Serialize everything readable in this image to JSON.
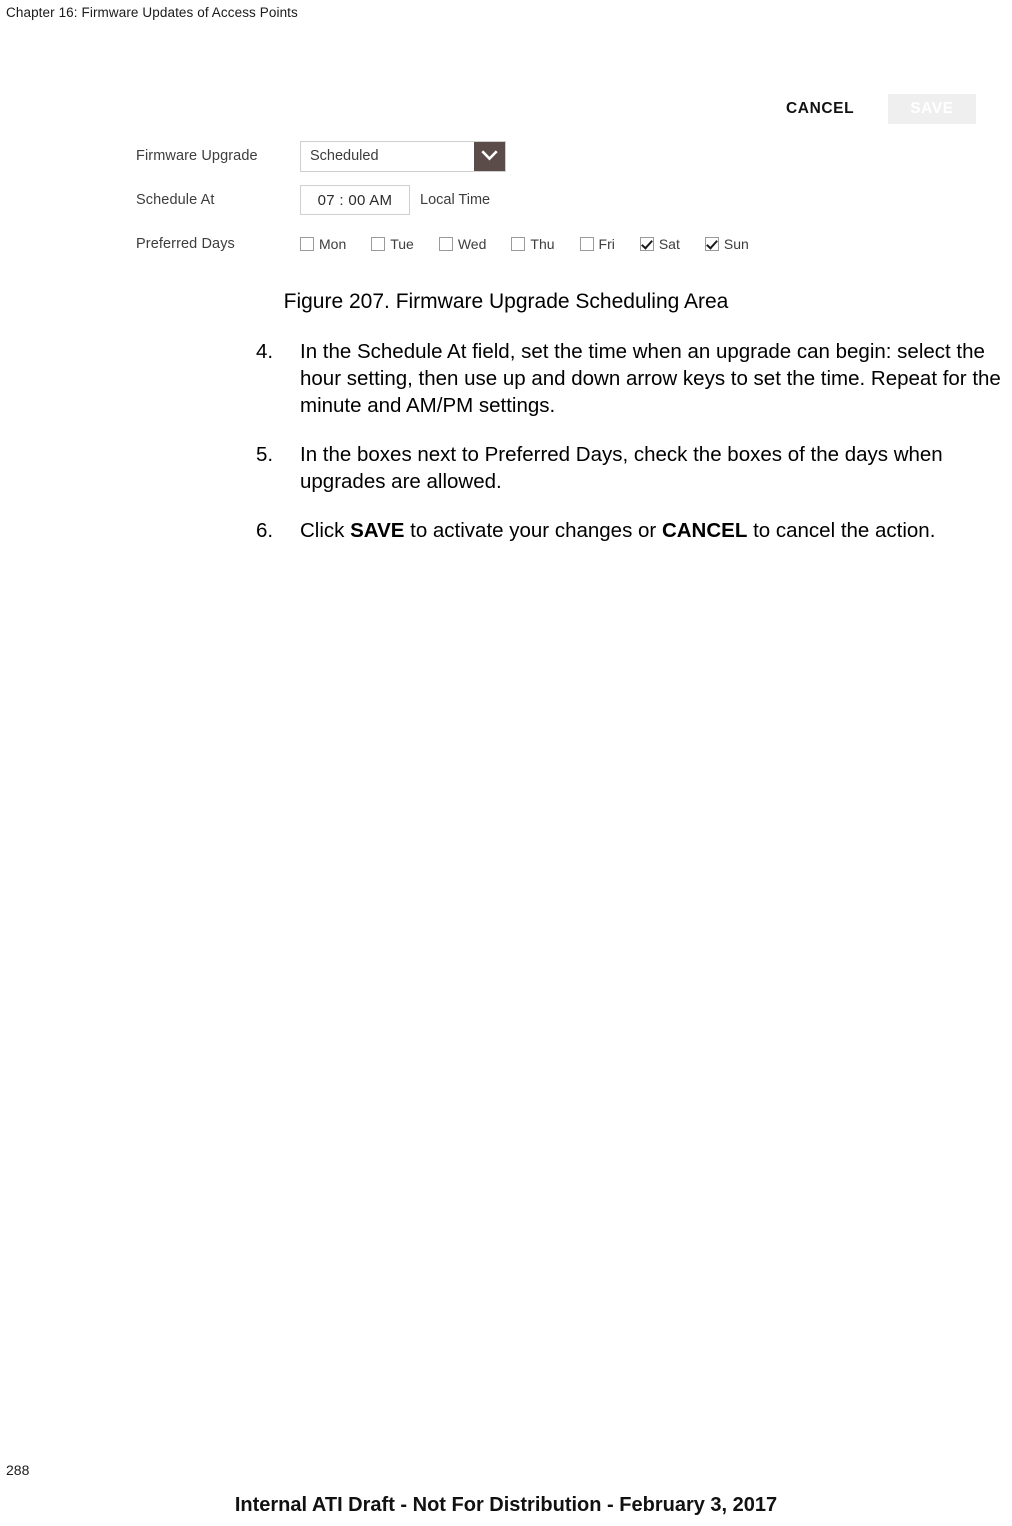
{
  "header": {
    "chapter": "Chapter 16: Firmware Updates of Access Points"
  },
  "figure": {
    "caption": "Figure 207. Firmware Upgrade Scheduling Area",
    "actions": {
      "cancel_label": "CANCEL",
      "save_label": "SAVE",
      "save_bg": "#efefef",
      "save_text_color": "#ffffff"
    },
    "form": {
      "firmware_upgrade": {
        "label": "Firmware Upgrade",
        "value": "Scheduled",
        "arrow_icon": "chevron-down-icon",
        "arrow_bg": "#5b4c49"
      },
      "schedule_at": {
        "label": "Schedule At",
        "value": "07 : 00 AM",
        "suffix": "Local Time"
      },
      "preferred_days": {
        "label": "Preferred Days",
        "days": [
          {
            "label": "Mon",
            "checked": false
          },
          {
            "label": "Tue",
            "checked": false
          },
          {
            "label": "Wed",
            "checked": false
          },
          {
            "label": "Thu",
            "checked": false
          },
          {
            "label": "Fri",
            "checked": false
          },
          {
            "label": "Sat",
            "checked": true
          },
          {
            "label": "Sun",
            "checked": true
          }
        ]
      }
    }
  },
  "steps": [
    {
      "number": "4.",
      "parts": [
        {
          "text": "In the Schedule At field, set the time when an upgrade can begin: select the hour setting, then use up and down arrow keys to set the time. Repeat for the minute and AM/PM settings.",
          "bold": false
        }
      ]
    },
    {
      "number": "5.",
      "parts": [
        {
          "text": "In the boxes next to Preferred Days, check the boxes of the days when upgrades are allowed.",
          "bold": false
        }
      ]
    },
    {
      "number": "6.",
      "parts": [
        {
          "text": "Click ",
          "bold": false
        },
        {
          "text": "SAVE",
          "bold": true
        },
        {
          "text": " to activate your changes or ",
          "bold": false
        },
        {
          "text": "CANCEL",
          "bold": true
        },
        {
          "text": " to cancel the action.",
          "bold": false
        }
      ]
    }
  ],
  "footer": {
    "page_number": "288",
    "draft_notice": "Internal ATI Draft - Not For Distribution - February 3, 2017"
  }
}
